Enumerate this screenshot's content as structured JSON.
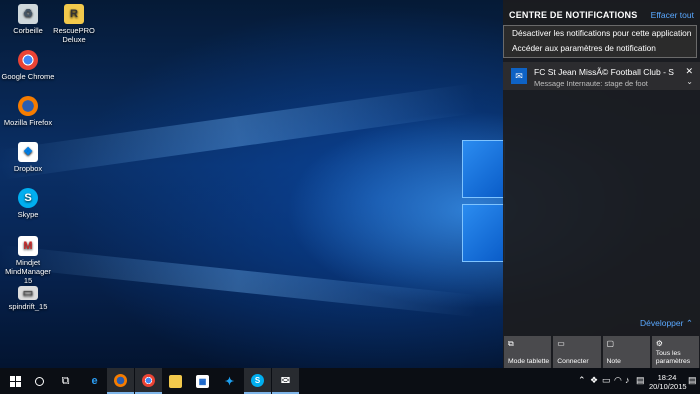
{
  "desktop": {
    "icons": [
      {
        "label": "Corbeille",
        "icon": "recycle-bin-icon"
      },
      {
        "label": "RescuePRO Deluxe",
        "icon": "rescuepro-icon"
      },
      {
        "label": "Google Chrome",
        "icon": "chrome-icon"
      },
      {
        "label": "Mozilla Firefox",
        "icon": "firefox-icon"
      },
      {
        "label": "Dropbox",
        "icon": "dropbox-icon"
      },
      {
        "label": "Skype",
        "icon": "skype-icon"
      },
      {
        "label": "Mindjet MindManager 15",
        "icon": "mindmanager-icon"
      },
      {
        "label": "spindrift_15",
        "icon": "file-icon"
      }
    ]
  },
  "action_center": {
    "title": "CENTRE DE NOTIFICATIONS",
    "clear_all": "Effacer tout",
    "context_menu": [
      "Désactiver les notifications pour cette application",
      "Accéder aux paramètres de notification"
    ],
    "notification": {
      "title": "FC St Jean MissÃ© Football Club - S",
      "body": "Message Internaute: stage de foot",
      "icon": "mail-icon"
    },
    "expand_label": "Développer",
    "quick_actions": [
      {
        "label": "Mode tablette",
        "icon": "tablet-mode-icon"
      },
      {
        "label": "Connecter",
        "icon": "connect-icon"
      },
      {
        "label": "Note",
        "icon": "note-icon"
      },
      {
        "label": "Tous les paramètres",
        "icon": "settings-icon"
      }
    ]
  },
  "taskbar": {
    "apps": [
      "start",
      "cortana",
      "task-view",
      "edge",
      "firefox",
      "chrome",
      "explorer",
      "store",
      "twitter",
      "skype",
      "mail"
    ],
    "clock_time": "18:24",
    "clock_date": "20/10/2015"
  },
  "colors": {
    "accent": "#5aa8ff",
    "action_center_bg": "#1c1c1e",
    "taskbar_bg": "#0b0e14"
  }
}
